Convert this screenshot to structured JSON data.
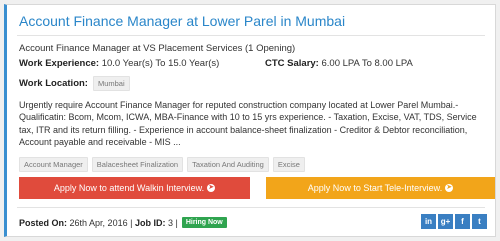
{
  "job": {
    "title": "Account Finance Manager at Lower Parel in Mumbai",
    "subtitle": "Account Finance Manager at VS Placement Services (1 Opening)",
    "experience_label": "Work Experience:",
    "experience_value": "10.0 Year(s) To 15.0 Year(s)",
    "salary_label": "CTC Salary:",
    "salary_value": "6.00 LPA To 8.00 LPA",
    "location_label": "Work Location:",
    "location_value": "Mumbai",
    "description": "Urgently require Account Finance Manager  for reputed construction company located at Lower Parel Mumbai.- Qualificatin: Bcom, Mcom, ICWA, MBA-Finance with 10 to 15 yrs experience. - Taxation, Excise, VAT, TDS, Service tax, ITR and its return filling. - Experience in account balance-sheet finalization - Creditor & Debtor reconciliation, Account payable and receivable - MIS ...",
    "skills": [
      "Account Manager",
      "Balacesheet Finalization",
      "Taxation And Auditing",
      "Excise"
    ]
  },
  "buttons": {
    "walkin": "Apply Now to attend Walkin Interview.",
    "tele": "Apply Now to Start Tele-Interview."
  },
  "footer": {
    "posted_label": "Posted On:",
    "posted_value": "26th Apr, 2016",
    "jobid_label": "Job ID:",
    "jobid_value": "3",
    "badge": "Hiring Now"
  },
  "social": [
    "in",
    "g+",
    "f",
    "t"
  ],
  "colors": {
    "title": "#2a86c9",
    "walkin": "#e04b3c",
    "tele": "#f2a51a",
    "badge": "#2fa44f",
    "social": "#3a7fc2"
  }
}
